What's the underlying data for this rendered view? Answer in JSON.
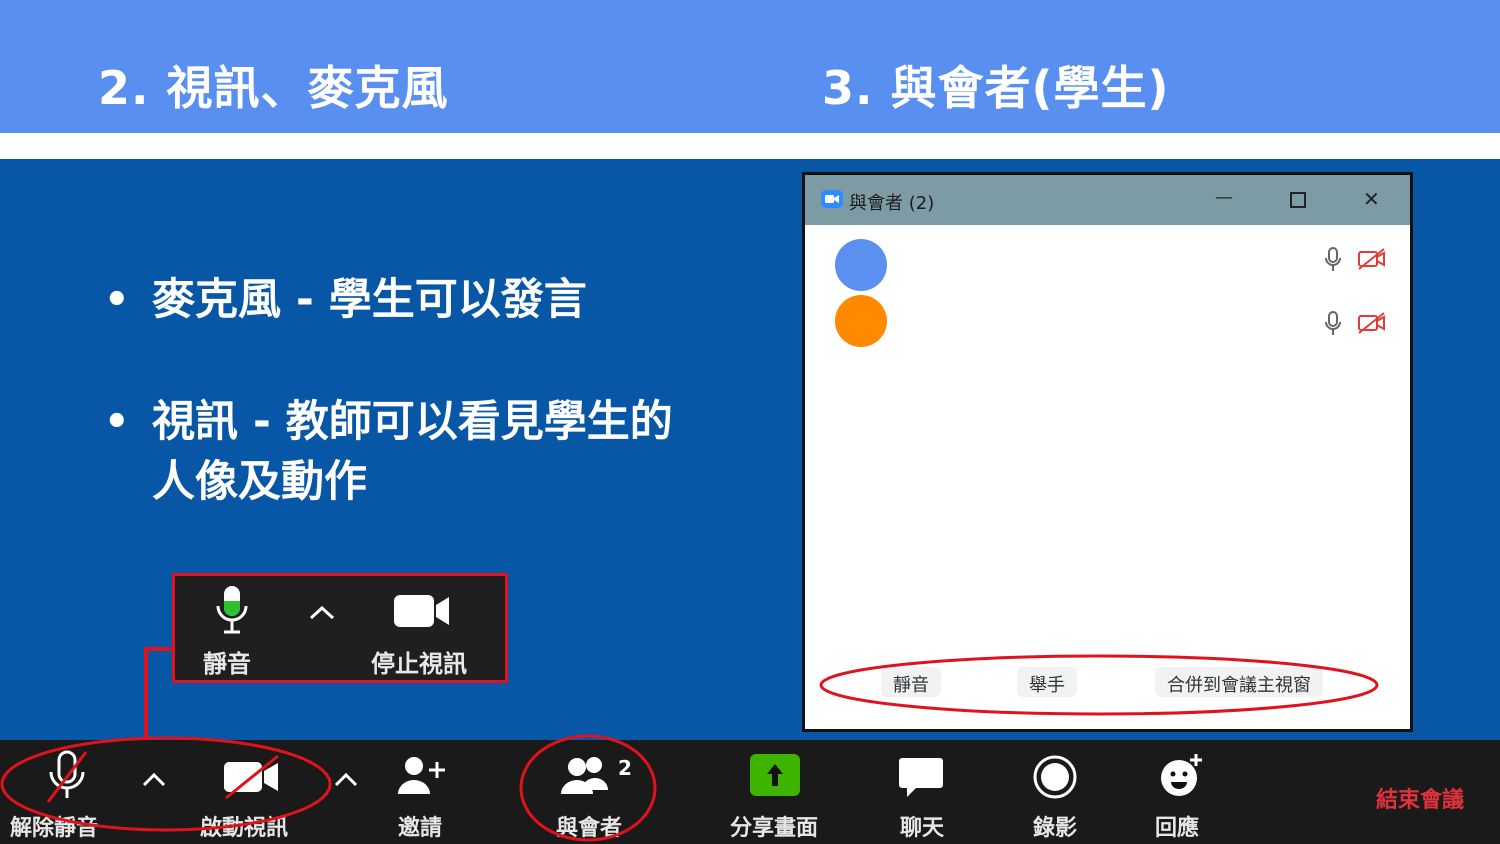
{
  "header": {
    "left_title": "2. 視訊、麥克風",
    "right_title": "3. 與會者(學生)"
  },
  "bullets": [
    {
      "dot": "•",
      "text": "麥克風 - 學生可以發言"
    },
    {
      "dot": "•",
      "text": "視訊 - 教師可以看見學生的人像及動作"
    }
  ],
  "mini_toolbar": {
    "mute_label": "靜音",
    "stop_video_label": "停止視訊",
    "mic_icon": "microphone-icon",
    "video_icon": "video-camera-icon",
    "caret": "^"
  },
  "participants_window": {
    "title": "與會者 (2)",
    "minimize": "—",
    "maximize": "☐",
    "close": "✕",
    "participants": [
      {
        "avatar_color": "#5b8ff0"
      },
      {
        "avatar_color": "#ff8a00"
      }
    ],
    "buttons": {
      "mute": "靜音",
      "raise_hand": "舉手",
      "merge": "合併到會議主視窗"
    }
  },
  "bottom_toolbar": {
    "unmute": "解除靜音",
    "start_video": "啟動視訊",
    "invite": "邀請",
    "participants": "與會者",
    "participants_count": "2",
    "share_screen": "分享畫面",
    "chat": "聊天",
    "record": "錄影",
    "reactions": "回應",
    "end_meeting": "結束會議",
    "caret": "^"
  },
  "colors": {
    "header_bg": "#588ff0",
    "main_bg": "#0757a6",
    "highlight_red": "#e0131c",
    "share_green": "#3fb400",
    "end_red": "#e0323c"
  }
}
